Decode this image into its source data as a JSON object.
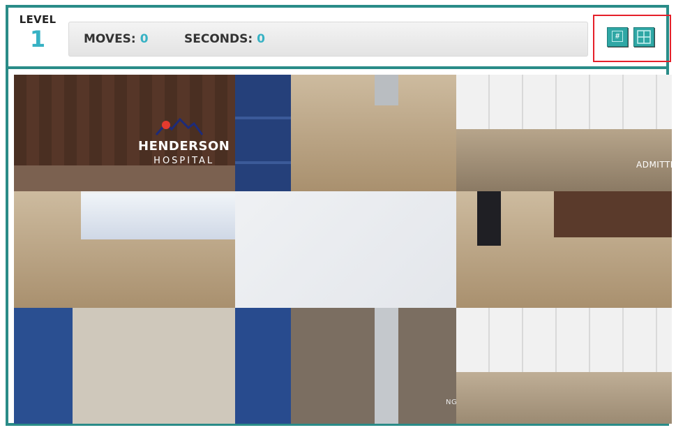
{
  "header": {
    "level_label": "LEVEL",
    "level_value": "1",
    "moves_label": "MOVES:",
    "moves_value": "0",
    "seconds_label": "SECONDS:",
    "seconds_value": "0",
    "number_toggle_glyph": "#",
    "buttons": [
      "number-toggle-icon",
      "grid-toggle-icon"
    ]
  },
  "puzzle": {
    "image_sign_line1": "HENDERSON",
    "image_sign_line2": "HOSPITAL",
    "image_admitting_text": "ADMITTI",
    "image_bottom_text": "NG",
    "grid": "3x3",
    "empty_tile": "center"
  },
  "colors": {
    "frame": "#2a8c88",
    "accent": "#37b2c4",
    "highlight": "#e5202a"
  }
}
